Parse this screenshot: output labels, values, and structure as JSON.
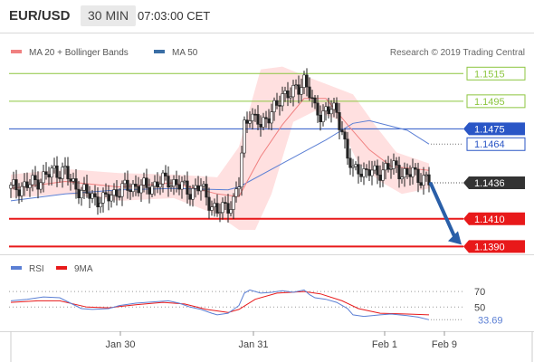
{
  "header": {
    "symbol": "EUR/USD",
    "timeframe": "30 MIN",
    "time": "07:03:00 CET"
  },
  "price_panel": {
    "legend": [
      {
        "label": "MA 20 + Bollinger Bands",
        "color": "#f08080"
      },
      {
        "label": "MA 50",
        "color": "#3a6ea5"
      }
    ],
    "credit": "Research © 2019 Trading Central",
    "levels": [
      {
        "value": 1.1515,
        "label": "1.1515",
        "color": "#8cc63f",
        "kind": "resistance"
      },
      {
        "value": 1.1495,
        "label": "1.1495",
        "color": "#8cc63f",
        "kind": "resistance"
      },
      {
        "value": 1.1475,
        "label": "1.1475",
        "color": "#2a56c6",
        "kind": "pivot"
      },
      {
        "value": 1.141,
        "label": "1.1410",
        "color": "#e8191a",
        "kind": "target"
      },
      {
        "value": 1.139,
        "label": "1.1390",
        "color": "#e8191a",
        "kind": "target"
      }
    ],
    "ma50_last": {
      "value": 1.1464,
      "label": "1.1464",
      "color": "#2a56c6"
    },
    "last_price": {
      "value": 1.1436,
      "label": "1.1436",
      "color": "#333333"
    },
    "forecast_arrow": {
      "from": 1.1436,
      "to": 1.139,
      "color": "#2a5fa8"
    }
  },
  "rsi_panel": {
    "legend": [
      {
        "label": "RSI",
        "color": "#5b7fd4"
      },
      {
        "label": "9MA",
        "color": "#e8191a"
      }
    ],
    "ticks": [
      {
        "value": 70,
        "label": "70"
      },
      {
        "value": 50,
        "label": "50"
      }
    ],
    "last_value": {
      "value": 33.69,
      "label": "33.69",
      "color": "#5b7fd4"
    }
  },
  "x_axis": {
    "labels": [
      "Jan 30",
      "Jan 31",
      "Feb 1",
      "Feb 9"
    ]
  },
  "chart_data": {
    "type": "candlestick",
    "title": "EUR/USD",
    "timeframe": "30 MIN",
    "ylim": [
      1.1385,
      1.1525
    ],
    "x_labels": [
      "Jan 30",
      "Jan 31",
      "Feb 1",
      "Feb 9"
    ],
    "close_path": [
      [
        0,
        1.1432
      ],
      [
        6,
        1.1434
      ],
      [
        10,
        1.1438
      ],
      [
        14,
        1.1442
      ],
      [
        16,
        1.1445
      ],
      [
        20,
        1.1444
      ],
      [
        22,
        1.1437
      ],
      [
        26,
        1.143
      ],
      [
        30,
        1.1426
      ],
      [
        34,
        1.1423
      ],
      [
        38,
        1.1429
      ],
      [
        42,
        1.1432
      ],
      [
        46,
        1.1434
      ],
      [
        50,
        1.1432
      ],
      [
        54,
        1.1436
      ],
      [
        58,
        1.1438
      ],
      [
        62,
        1.1434
      ],
      [
        66,
        1.143
      ],
      [
        70,
        1.1433
      ],
      [
        72,
        1.1426
      ],
      [
        74,
        1.142
      ],
      [
        76,
        1.1414
      ],
      [
        78,
        1.1418
      ],
      [
        80,
        1.142
      ],
      [
        82,
        1.1422
      ],
      [
        84,
        1.1435
      ],
      [
        86,
        1.1478
      ],
      [
        88,
        1.1487
      ],
      [
        90,
        1.148
      ],
      [
        92,
        1.1478
      ],
      [
        94,
        1.1483
      ],
      [
        96,
        1.1488
      ],
      [
        98,
        1.149
      ],
      [
        100,
        1.15
      ],
      [
        102,
        1.1502
      ],
      [
        104,
        1.1501
      ],
      [
        106,
        1.1503
      ],
      [
        108,
        1.1512
      ],
      [
        110,
        1.1502
      ],
      [
        112,
        1.1487
      ],
      [
        114,
        1.1485
      ],
      [
        116,
        1.149
      ],
      [
        118,
        1.1489
      ],
      [
        120,
        1.1485
      ],
      [
        122,
        1.1475
      ],
      [
        124,
        1.1455
      ],
      [
        126,
        1.1443
      ],
      [
        128,
        1.1447
      ],
      [
        130,
        1.1444
      ],
      [
        134,
        1.1443
      ],
      [
        138,
        1.1446
      ],
      [
        142,
        1.1448
      ],
      [
        144,
        1.1443
      ],
      [
        146,
        1.144
      ],
      [
        148,
        1.1445
      ],
      [
        150,
        1.1441
      ],
      [
        152,
        1.1438
      ],
      [
        154,
        1.1436
      ]
    ],
    "series": [
      {
        "name": "MA 20",
        "values": [
          [
            0,
            1.1432
          ],
          [
            20,
            1.1437
          ],
          [
            40,
            1.1433
          ],
          [
            60,
            1.1436
          ],
          [
            76,
            1.1428
          ],
          [
            84,
            1.1426
          ],
          [
            92,
            1.1455
          ],
          [
            100,
            1.1478
          ],
          [
            108,
            1.1497
          ],
          [
            116,
            1.1497
          ],
          [
            124,
            1.1478
          ],
          [
            132,
            1.146
          ],
          [
            140,
            1.1448
          ],
          [
            154,
            1.1445
          ]
        ]
      },
      {
        "name": "MA 50",
        "values": [
          [
            0,
            1.1423
          ],
          [
            20,
            1.1428
          ],
          [
            40,
            1.1431
          ],
          [
            60,
            1.1432
          ],
          [
            80,
            1.1431
          ],
          [
            84,
            1.1433
          ],
          [
            100,
            1.145
          ],
          [
            116,
            1.1467
          ],
          [
            126,
            1.1479
          ],
          [
            132,
            1.1481
          ],
          [
            146,
            1.1474
          ],
          [
            154,
            1.1464
          ]
        ]
      },
      {
        "name": "Bollinger Upper",
        "values": [
          [
            0,
            1.1442
          ],
          [
            20,
            1.1446
          ],
          [
            40,
            1.1443
          ],
          [
            60,
            1.1442
          ],
          [
            76,
            1.144
          ],
          [
            84,
            1.1462
          ],
          [
            92,
            1.1518
          ],
          [
            100,
            1.152
          ],
          [
            110,
            1.1512
          ],
          [
            118,
            1.1506
          ],
          [
            126,
            1.15
          ],
          [
            134,
            1.1478
          ],
          [
            142,
            1.1458
          ],
          [
            154,
            1.145
          ]
        ]
      },
      {
        "name": "Bollinger Lower",
        "values": [
          [
            0,
            1.1425
          ],
          [
            20,
            1.1428
          ],
          [
            40,
            1.1423
          ],
          [
            60,
            1.1425
          ],
          [
            76,
            1.1413
          ],
          [
            84,
            1.1402
          ],
          [
            90,
            1.1402
          ],
          [
            96,
            1.1428
          ],
          [
            104,
            1.148
          ],
          [
            112,
            1.1488
          ],
          [
            120,
            1.1482
          ],
          [
            128,
            1.145
          ],
          [
            136,
            1.1437
          ],
          [
            144,
            1.1428
          ],
          [
            154,
            1.1432
          ]
        ]
      },
      {
        "name": "RSI",
        "values": [
          [
            0,
            58
          ],
          [
            6,
            60
          ],
          [
            12,
            63
          ],
          [
            18,
            62
          ],
          [
            22,
            55
          ],
          [
            26,
            48
          ],
          [
            30,
            47
          ],
          [
            36,
            48
          ],
          [
            40,
            52
          ],
          [
            46,
            55
          ],
          [
            50,
            56
          ],
          [
            54,
            57
          ],
          [
            58,
            58
          ],
          [
            62,
            55
          ],
          [
            66,
            50
          ],
          [
            70,
            47
          ],
          [
            74,
            42
          ],
          [
            76,
            40
          ],
          [
            80,
            42
          ],
          [
            84,
            52
          ],
          [
            86,
            68
          ],
          [
            88,
            72
          ],
          [
            92,
            68
          ],
          [
            96,
            69
          ],
          [
            100,
            71
          ],
          [
            104,
            69
          ],
          [
            108,
            72
          ],
          [
            110,
            66
          ],
          [
            112,
            62
          ],
          [
            116,
            60
          ],
          [
            120,
            56
          ],
          [
            124,
            48
          ],
          [
            126,
            40
          ],
          [
            130,
            38
          ],
          [
            136,
            40
          ],
          [
            140,
            41
          ],
          [
            146,
            39
          ],
          [
            150,
            37
          ],
          [
            154,
            33.69
          ]
        ]
      },
      {
        "name": "9MA",
        "values": [
          [
            0,
            56
          ],
          [
            10,
            58
          ],
          [
            18,
            58
          ],
          [
            28,
            50
          ],
          [
            36,
            49
          ],
          [
            46,
            53
          ],
          [
            56,
            56
          ],
          [
            64,
            54
          ],
          [
            72,
            47
          ],
          [
            80,
            43
          ],
          [
            84,
            47
          ],
          [
            90,
            60
          ],
          [
            98,
            68
          ],
          [
            108,
            70
          ],
          [
            114,
            67
          ],
          [
            122,
            58
          ],
          [
            128,
            48
          ],
          [
            136,
            42
          ],
          [
            146,
            41
          ],
          [
            154,
            40
          ]
        ]
      }
    ]
  }
}
